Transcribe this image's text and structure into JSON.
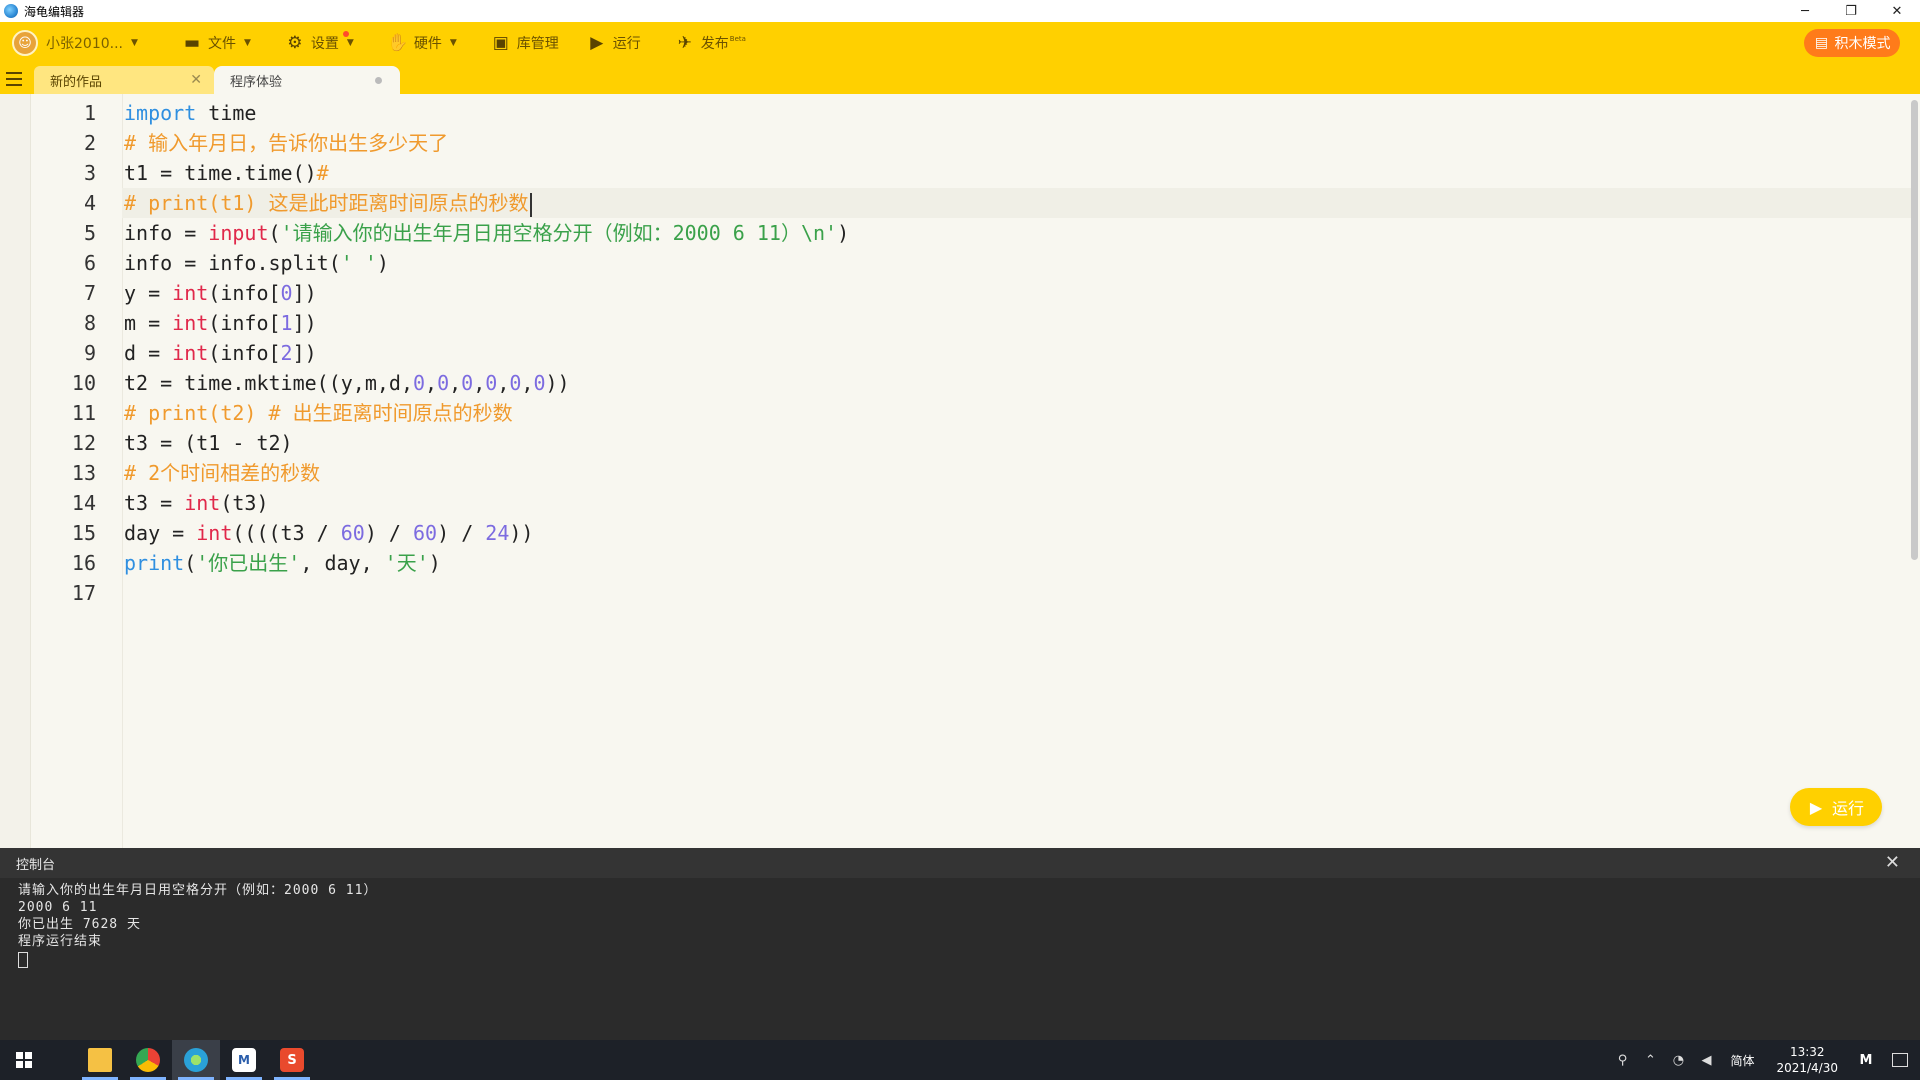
{
  "app": {
    "title": "海龟编辑器"
  },
  "window": {
    "minimize": "─",
    "restore": "❐",
    "close": "✕"
  },
  "toolbar": {
    "user_name": "小张2010...",
    "file_label": "文件",
    "settings_label": "设置",
    "hardware_label": "硬件",
    "library_label": "库管理",
    "run_label": "运行",
    "publish_label": "发布",
    "publish_sup": "Beta",
    "block_mode_label": "积木模式"
  },
  "tabs": [
    {
      "label": "新的作品",
      "close": "✕"
    },
    {
      "label": "程序体验"
    }
  ],
  "editor": {
    "line_numbers": [
      "1",
      "2",
      "3",
      "4",
      "5",
      "6",
      "7",
      "8",
      "9",
      "10",
      "11",
      "12",
      "13",
      "14",
      "15",
      "16",
      "17"
    ],
    "lines": [
      [
        {
          "t": "import",
          "c": "kw"
        },
        {
          "t": " time",
          "c": ""
        }
      ],
      [
        {
          "t": "# 输入年月日，告诉你出生多少天了",
          "c": "cm"
        }
      ],
      [
        {
          "t": "t1 = time.time()",
          "c": ""
        },
        {
          "t": "#",
          "c": "cm"
        }
      ],
      [
        {
          "t": "# print(t1) 这是此时距离时间原点的秒数",
          "c": "cm"
        }
      ],
      [
        {
          "t": "info = ",
          "c": ""
        },
        {
          "t": "input",
          "c": "bi"
        },
        {
          "t": "(",
          "c": ""
        },
        {
          "t": "'请输入你的出生年月日用空格分开（例如：2000 6 11）\\n'",
          "c": "st"
        },
        {
          "t": ")",
          "c": ""
        }
      ],
      [
        {
          "t": "info = info.split(",
          "c": ""
        },
        {
          "t": "' '",
          "c": "st"
        },
        {
          "t": ")",
          "c": ""
        }
      ],
      [
        {
          "t": "y = ",
          "c": ""
        },
        {
          "t": "int",
          "c": "bi"
        },
        {
          "t": "(info[",
          "c": ""
        },
        {
          "t": "0",
          "c": "nu"
        },
        {
          "t": "])",
          "c": ""
        }
      ],
      [
        {
          "t": "m = ",
          "c": ""
        },
        {
          "t": "int",
          "c": "bi"
        },
        {
          "t": "(info[",
          "c": ""
        },
        {
          "t": "1",
          "c": "nu"
        },
        {
          "t": "])",
          "c": ""
        }
      ],
      [
        {
          "t": "d = ",
          "c": ""
        },
        {
          "t": "int",
          "c": "bi"
        },
        {
          "t": "(info[",
          "c": ""
        },
        {
          "t": "2",
          "c": "nu"
        },
        {
          "t": "])",
          "c": ""
        }
      ],
      [
        {
          "t": "t2 = time.mktime((y,m,d,",
          "c": ""
        },
        {
          "t": "0",
          "c": "nu"
        },
        {
          "t": ",",
          "c": ""
        },
        {
          "t": "0",
          "c": "nu"
        },
        {
          "t": ",",
          "c": ""
        },
        {
          "t": "0",
          "c": "nu"
        },
        {
          "t": ",",
          "c": ""
        },
        {
          "t": "0",
          "c": "nu"
        },
        {
          "t": ",",
          "c": ""
        },
        {
          "t": "0",
          "c": "nu"
        },
        {
          "t": ",",
          "c": ""
        },
        {
          "t": "0",
          "c": "nu"
        },
        {
          "t": "))",
          "c": ""
        }
      ],
      [
        {
          "t": "# print(t2) # 出生距离时间原点的秒数",
          "c": "cm"
        }
      ],
      [
        {
          "t": "t3 = (t1 - t2)",
          "c": ""
        }
      ],
      [
        {
          "t": "# 2个时间相差的秒数",
          "c": "cm"
        }
      ],
      [
        {
          "t": "t3 = ",
          "c": ""
        },
        {
          "t": "int",
          "c": "bi"
        },
        {
          "t": "(t3)",
          "c": ""
        }
      ],
      [
        {
          "t": "day = ",
          "c": ""
        },
        {
          "t": "int",
          "c": "bi"
        },
        {
          "t": "((((t3 / ",
          "c": ""
        },
        {
          "t": "60",
          "c": "nu"
        },
        {
          "t": ") / ",
          "c": ""
        },
        {
          "t": "60",
          "c": "nu"
        },
        {
          "t": ") / ",
          "c": ""
        },
        {
          "t": "24",
          "c": "nu"
        },
        {
          "t": "))",
          "c": ""
        }
      ],
      [
        {
          "t": "print",
          "c": "kw"
        },
        {
          "t": "(",
          "c": ""
        },
        {
          "t": "'你已出生'",
          "c": "st"
        },
        {
          "t": ", day, ",
          "c": ""
        },
        {
          "t": "'天'",
          "c": "st"
        },
        {
          "t": ")",
          "c": ""
        }
      ],
      []
    ],
    "run_button_label": "运行"
  },
  "console": {
    "title": "控制台",
    "close": "✕",
    "output": [
      "请输入你的出生年月日用空格分开（例如：2000 6 11）",
      "2000 6 11",
      "你已出生 7628 天",
      "程序运行结束"
    ]
  },
  "taskbar": {
    "apps": [
      {
        "name": "file-explorer-icon",
        "glyph": ""
      },
      {
        "name": "chrome-icon",
        "glyph": ""
      },
      {
        "name": "turtle-editor-icon",
        "glyph": ""
      },
      {
        "name": "mindmaster-icon",
        "glyph": "M"
      },
      {
        "name": "sogou-icon",
        "glyph": "S"
      }
    ],
    "ime": "简体",
    "time": "13:32",
    "date": "2021/4/30"
  }
}
